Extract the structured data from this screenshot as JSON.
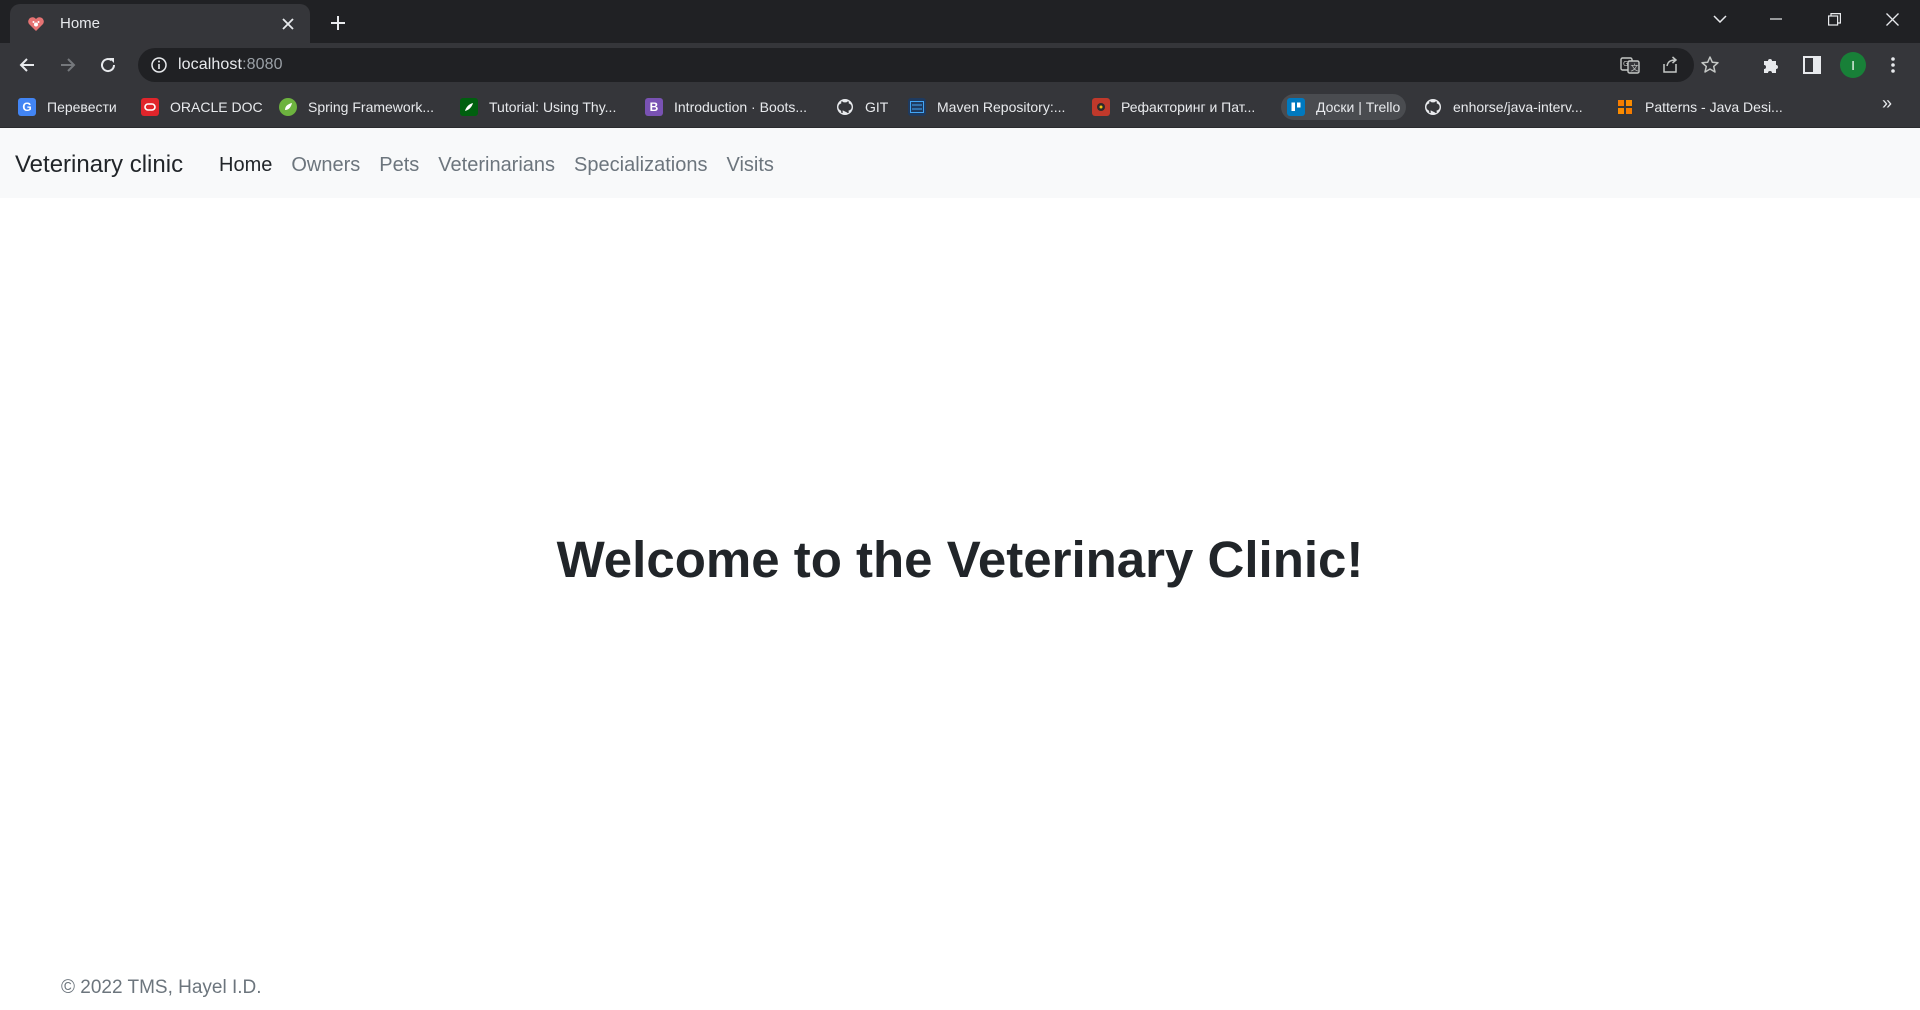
{
  "browser": {
    "tab": {
      "title": "Home",
      "favicon": "paw-heart-icon"
    },
    "url": {
      "host": "localhost",
      "port": ":8080"
    },
    "profile_initial": "I",
    "bookmarks": [
      {
        "label": "Перевести",
        "icon": "translate-icon",
        "color": "#4285f4"
      },
      {
        "label": "ORACLE DOC",
        "icon": "oracle-icon",
        "color": "#e0252b"
      },
      {
        "label": "Spring Framework...",
        "icon": "spring-icon",
        "color": "#6db33f"
      },
      {
        "label": "Tutorial: Using Thy...",
        "icon": "thymeleaf-icon",
        "color": "#005f0f"
      },
      {
        "label": "Introduction · Boots...",
        "icon": "bootstrap-icon",
        "color": "#7952b3"
      },
      {
        "label": "GIT",
        "icon": "github-icon",
        "color": "#ffffff"
      },
      {
        "label": "Maven Repository:...",
        "icon": "maven-icon",
        "color": "#1e88e5"
      },
      {
        "label": "Рефакторинг и Пат...",
        "icon": "refactoring-icon",
        "color": "#c0392b"
      },
      {
        "label": "Доски | Trello",
        "icon": "trello-icon",
        "color": "#0079bf"
      },
      {
        "label": "enhorse/java-interv...",
        "icon": "github-icon",
        "color": "#ffffff"
      },
      {
        "label": "Patterns - Java Desi...",
        "icon": "patterns-icon",
        "color": "#f57c00"
      }
    ],
    "bookmarks_more": "»"
  },
  "site": {
    "brand": "Veterinary clinic",
    "nav": [
      {
        "label": "Home",
        "active": true
      },
      {
        "label": "Owners"
      },
      {
        "label": "Pets"
      },
      {
        "label": "Veterinarians"
      },
      {
        "label": "Specializations"
      },
      {
        "label": "Visits"
      }
    ],
    "heading": "Welcome to the Veterinary Clinic!",
    "footer": "© 2022 TMS, Hayel I.D."
  }
}
